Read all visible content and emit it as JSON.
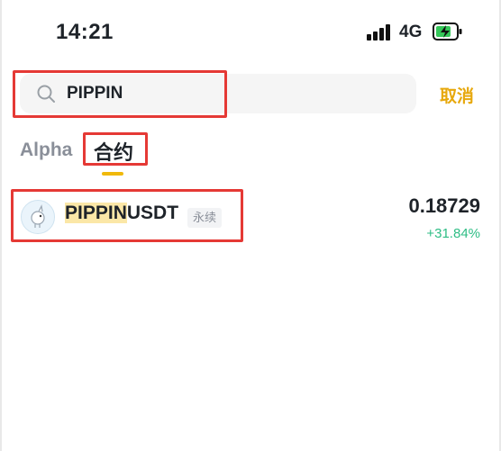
{
  "status_bar": {
    "time": "14:21",
    "network": "4G",
    "icons": [
      "signal-icon",
      "battery-charging-icon"
    ]
  },
  "search": {
    "query": "PIPPIN",
    "icon": "search-icon",
    "cancel_label": "取消"
  },
  "tabs": [
    {
      "label": "Alpha",
      "active": false
    },
    {
      "label": "合约",
      "active": true
    }
  ],
  "results": [
    {
      "symbol_highlight": "PIPPIN",
      "symbol_rest": "USDT",
      "tag": "永续",
      "price": "0.18729",
      "change": "+31.84%"
    }
  ],
  "colors": {
    "accent": "#f0b90b",
    "cancel": "#e7a80c",
    "positive": "#2ebd85",
    "highlight": "#fbe7a7",
    "annotation": "#e53935"
  }
}
